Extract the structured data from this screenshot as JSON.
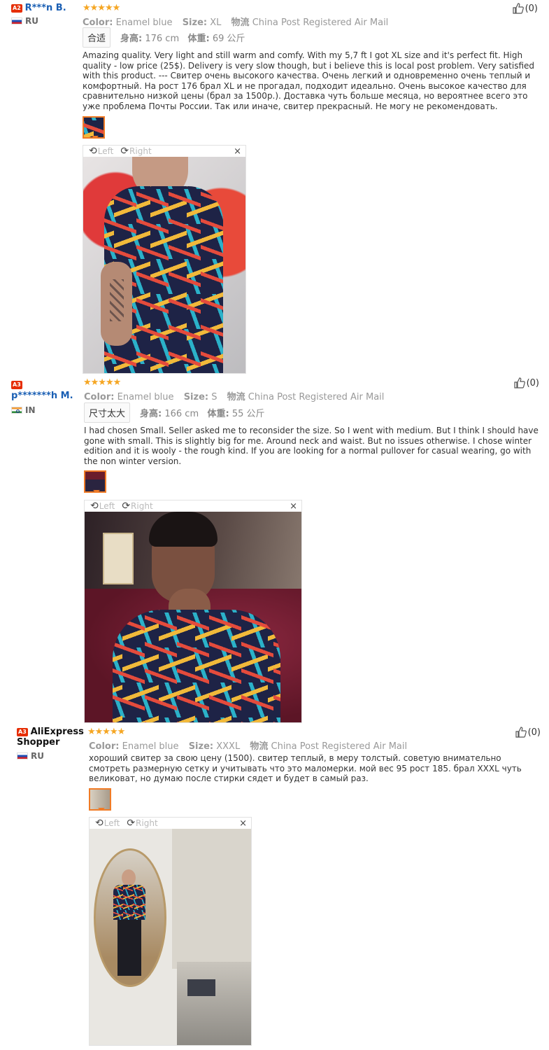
{
  "reviews": [
    {
      "level": "A2",
      "name": "R***n B.",
      "country": "RU",
      "stars": "★★★★★",
      "color_label": "Color:",
      "color": "Enamel blue",
      "size_label": "Size:",
      "size": "XL",
      "ship_label": "物流",
      "ship": "China Post Registered Air Mail",
      "fit_tag": "合适",
      "height_label": "身高:",
      "height": "176 cm",
      "weight_label": "体重:",
      "weight": "69 公斤",
      "text": "Amazing quality. Very light and still warm and comfy. With my 5,7 ft I got XL size and it's perfect fit. High quality - low price (25$). Delivery is very slow though, but i believe this is local post problem. Very satisfied with this product. --- Свитер очень высокого качества. Очень легкий и одновременно очень теплый и комфортный. На рост 176 брал XL и не прогадал, подходит идеально. Очень высокое качество для сравнительно низкой цены (брал за 1500р.). Доставка чуть больше месяца, но вероятнее всего это уже проблема Почты России. Так или иначе, свитер прекрасный. Не могу не рекомендовать.",
      "likes": "(0)"
    },
    {
      "level": "A3",
      "name": "p*******h M.",
      "country": "IN",
      "stars": "★★★★★",
      "color_label": "Color:",
      "color": "Enamel blue",
      "size_label": "Size:",
      "size": "S",
      "ship_label": "物流",
      "ship": "China Post Registered Air Mail",
      "fit_tag": "尺寸太大",
      "height_label": "身高:",
      "height": "166 cm",
      "weight_label": "体重:",
      "weight": "55 公斤",
      "text": "I had chosen Small. Seller asked me to reconsider the size. So I went with medium. But I think I should have gone with small. This is slightly big for me. Around neck and waist. But no issues otherwise. I chose winter edition and it is wooly - the rough kind. If you are looking for a normal pullover for casual wearing, go with the non winter version.",
      "likes": "(0)"
    },
    {
      "level": "A3",
      "name": "AliExpress Shopper",
      "country": "RU",
      "stars": "★★★★★",
      "color_label": "Color:",
      "color": "Enamel blue",
      "size_label": "Size:",
      "size": "XXXL",
      "ship_label": "物流",
      "ship": "China Post Registered Air Mail",
      "text": "хороший свитер за свою цену (1500). свитер теплый, в меру толстый. советую внимательно смотреть размерную сетку и учитывать что это маломерки. мой вес 95 рост 185. брал XXXL чуть великоват, но думаю после стирки сядет и будет в самый раз.",
      "likes": "(0)"
    }
  ],
  "viewer": {
    "left": "Left",
    "right": "Right",
    "close": "×"
  }
}
